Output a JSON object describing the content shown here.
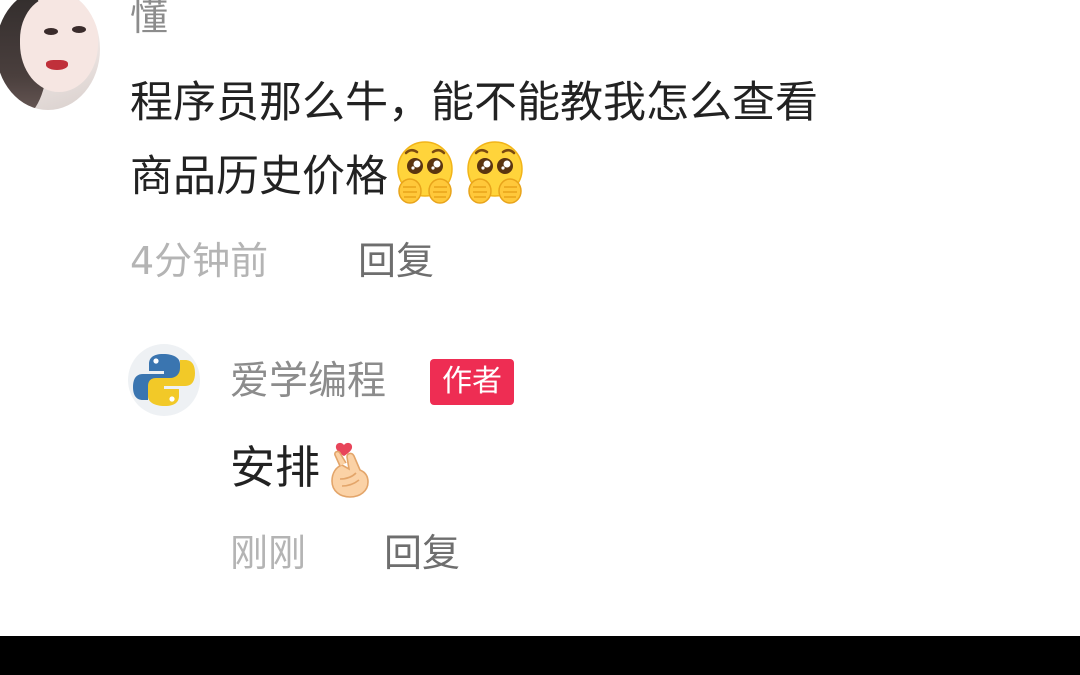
{
  "comment": {
    "username_partial": "懂",
    "text_line1": "程序员那么牛，能不能教我怎么查看",
    "text_line2": "商品历史价格",
    "emoji": "pleading-face-emoji",
    "timestamp": "4分钟前",
    "reply_label": "回复"
  },
  "author_reply": {
    "username": "爱学编程",
    "badge": "作者",
    "text": "安排",
    "emoji": "finger-heart-emoji",
    "timestamp": "刚刚",
    "reply_label": "回复"
  },
  "colors": {
    "background": "#ffffff",
    "text_primary": "#222222",
    "text_secondary": "#8c8c8c",
    "timestamp": "#b4b4b4",
    "badge": "#ee2d53"
  }
}
